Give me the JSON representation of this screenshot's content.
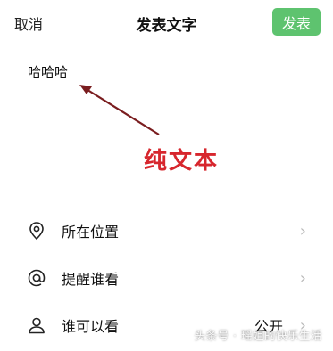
{
  "nav": {
    "cancel_label": "取消",
    "title": "发表文字",
    "publish_label": "发表"
  },
  "editor": {
    "text": "哈哈哈"
  },
  "annotation": {
    "label": "纯文本"
  },
  "options": [
    {
      "label": "所在位置",
      "icon": "location-pin-icon",
      "value": ""
    },
    {
      "label": "提醒谁看",
      "icon": "at-sign-icon",
      "value": ""
    },
    {
      "label": "谁可以看",
      "icon": "person-icon",
      "value": "公开"
    }
  ],
  "watermark": "头条号 · 瑶姐的快乐生活",
  "colors": {
    "accent": "#5ec36f",
    "annotation": "#d7262d"
  }
}
